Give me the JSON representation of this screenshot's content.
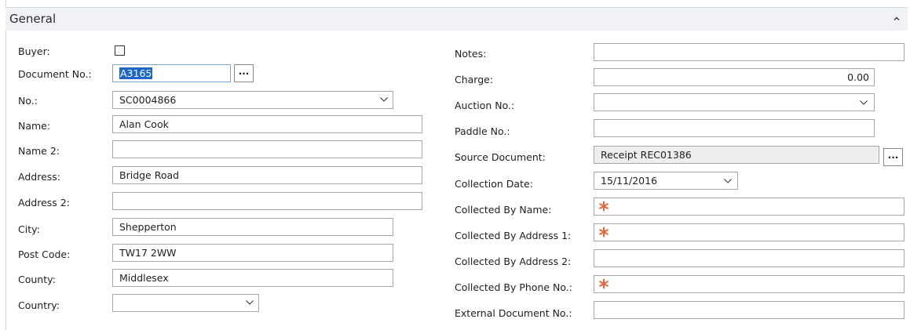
{
  "section": {
    "title": "General"
  },
  "left": {
    "buyer": {
      "label": "Buyer:"
    },
    "document_no": {
      "label": "Document No.:",
      "value": "A3165",
      "button": "..."
    },
    "no": {
      "label": "No.:",
      "value": "SC0004866"
    },
    "name": {
      "label": "Name:",
      "value": "Alan Cook"
    },
    "name2": {
      "label": "Name 2:",
      "value": ""
    },
    "address": {
      "label": "Address:",
      "value": "Bridge Road"
    },
    "address2": {
      "label": "Address 2:",
      "value": ""
    },
    "city": {
      "label": "City:",
      "value": "Shepperton"
    },
    "post_code": {
      "label": "Post Code:",
      "value": "TW17 2WW"
    },
    "county": {
      "label": "County:",
      "value": "Middlesex"
    },
    "country": {
      "label": "Country:",
      "value": ""
    }
  },
  "right": {
    "notes": {
      "label": "Notes:",
      "value": ""
    },
    "charge": {
      "label": "Charge:",
      "value": "0.00"
    },
    "auction_no": {
      "label": "Auction No.:",
      "value": ""
    },
    "paddle_no": {
      "label": "Paddle No.:",
      "value": ""
    },
    "source_document": {
      "label": "Source Document:",
      "value": "Receipt REC01386",
      "button": "..."
    },
    "collection_date": {
      "label": "Collection Date:",
      "value": "15/11/2016"
    },
    "collected_by_name": {
      "label": "Collected By Name:",
      "value": ""
    },
    "collected_by_address1": {
      "label": "Collected By Address 1:",
      "value": ""
    },
    "collected_by_address2": {
      "label": "Collected By Address 2:",
      "value": ""
    },
    "collected_by_phone": {
      "label": "Collected By Phone No.:",
      "value": ""
    },
    "external_document_no": {
      "label": "External Document No.:",
      "value": ""
    }
  },
  "colors": {
    "required_marker": "#e8663d",
    "selection": "#1e66c8",
    "header_bg": "#f0f2f5"
  },
  "icons": {
    "collapse": "chevron-up-icon",
    "dropdown": "chevron-down-icon",
    "required": "asterisk-icon"
  }
}
